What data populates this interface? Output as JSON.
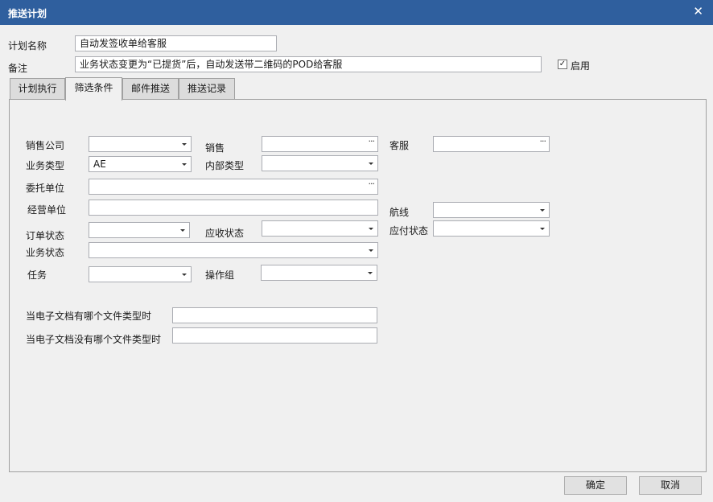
{
  "window": {
    "title": "推送计划",
    "close_glyph": "✕"
  },
  "plan": {
    "name_label": "计划名称",
    "name_value": "自动发签收单给客服",
    "remark_label": "备注",
    "remark_value": "业务状态变更为“已提货”后，自动发送带二维码的POD给客服",
    "enable_label": "启用",
    "enable_checked": true,
    "check_glyph": "✓"
  },
  "tabs": [
    {
      "label": "计划执行"
    },
    {
      "label": "筛选条件",
      "active": true
    },
    {
      "label": "邮件推送"
    },
    {
      "label": "推送记录"
    }
  ],
  "filters": {
    "sales_company": {
      "label": "销售公司",
      "value": ""
    },
    "sales": {
      "label": "销售",
      "value": "",
      "button": "···"
    },
    "customer_service": {
      "label": "客服",
      "value": "",
      "button": "···"
    },
    "business_type": {
      "label": "业务类型",
      "value": "AE"
    },
    "internal_type": {
      "label": "内部类型",
      "value": ""
    },
    "consignor": {
      "label": "委托单位",
      "value": "",
      "button": "···"
    },
    "operating_unit": {
      "label": "经营单位",
      "value": ""
    },
    "route": {
      "label": "航线",
      "value": ""
    },
    "order_status": {
      "label": "订单状态",
      "value": ""
    },
    "receivable_status": {
      "label": "应收状态",
      "value": ""
    },
    "payable_status": {
      "label": "应付状态",
      "value": ""
    },
    "business_status": {
      "label": "业务状态",
      "value": ""
    },
    "task": {
      "label": "任务",
      "value": ""
    },
    "operation_group": {
      "label": "操作组",
      "value": ""
    },
    "doc_has_type": {
      "label": "当电子文档有哪个文件类型时",
      "value": ""
    },
    "doc_missing_type": {
      "label": "当电子文档没有哪个文件类型时",
      "value": ""
    }
  },
  "footer": {
    "ok_label": "确定",
    "cancel_label": "取消"
  }
}
